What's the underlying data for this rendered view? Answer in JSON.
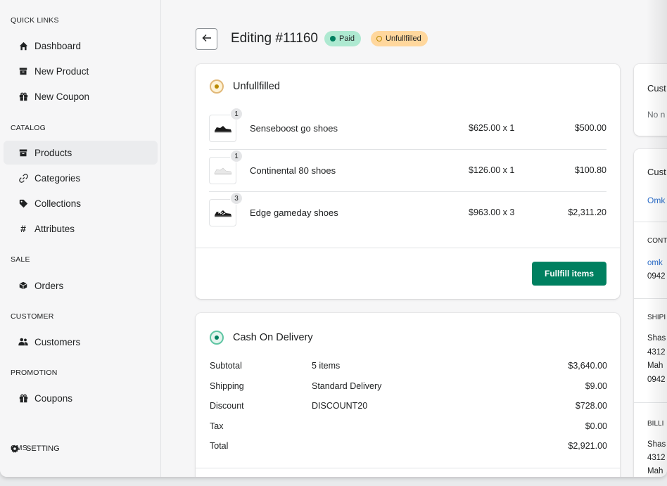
{
  "sidebar": {
    "sections": [
      {
        "title": "QUICK LINKS",
        "items": [
          {
            "label": "Dashboard",
            "icon": "home-icon"
          },
          {
            "label": "New Product",
            "icon": "box-icon"
          },
          {
            "label": "New Coupon",
            "icon": "gift-icon"
          }
        ]
      },
      {
        "title": "CATALOG",
        "items": [
          {
            "label": "Products",
            "icon": "box-icon",
            "active": true
          },
          {
            "label": "Categories",
            "icon": "link-icon"
          },
          {
            "label": "Collections",
            "icon": "tag-icon"
          },
          {
            "label": "Attributes",
            "icon": "hash-icon"
          }
        ]
      },
      {
        "title": "SALE",
        "items": [
          {
            "label": "Orders",
            "icon": "cube-icon"
          }
        ]
      },
      {
        "title": "CUSTOMER",
        "items": [
          {
            "label": "Customers",
            "icon": "users-icon"
          }
        ]
      },
      {
        "title": "PROMOTION",
        "items": [
          {
            "label": "Coupons",
            "icon": "gift-icon"
          }
        ]
      },
      {
        "title": "CMS",
        "items": [
          {
            "label": "SETTING",
            "icon": "gear-icon"
          }
        ]
      }
    ]
  },
  "header": {
    "title": "Editing #11160",
    "badges": {
      "paid": "Paid",
      "unfulfilled": "Unfullfilled"
    }
  },
  "unfulfilled_card": {
    "title": "Unfullfilled",
    "items": [
      {
        "qty": "1",
        "name": "Senseboost go shoes",
        "price": "$625.00 x 1",
        "total": "$500.00"
      },
      {
        "qty": "1",
        "name": "Continental 80 shoes",
        "price": "$126.00 x 1",
        "total": "$100.80"
      },
      {
        "qty": "3",
        "name": "Edge gameday shoes",
        "price": "$963.00 x 3",
        "total": "$2,311.20"
      }
    ],
    "button": "Fullfill items"
  },
  "payment_card": {
    "title": "Cash On Delivery",
    "rows": [
      {
        "label": "Subtotal",
        "detail": "5 items",
        "amount": "$3,640.00"
      },
      {
        "label": "Shipping",
        "detail": "Standard Delivery",
        "amount": "$9.00"
      },
      {
        "label": "Discount",
        "detail": "DISCOUNT20",
        "amount": "$728.00"
      },
      {
        "label": "Tax",
        "detail": "",
        "amount": "$0.00"
      },
      {
        "label": "Total",
        "detail": "",
        "amount": "$2,921.00"
      }
    ]
  },
  "right_panel": {
    "card1_title": "Cust",
    "card1_text": "No n",
    "card2_title": "Cust",
    "card2_link": "Omk",
    "contact_label": "CONT",
    "contact_email": "omk",
    "contact_phone": "0942",
    "shipping_label": "SHIPI",
    "shipping_lines": [
      "Shas",
      "4312",
      "Mah",
      "0942"
    ],
    "billing_label": "BILLI",
    "billing_lines": [
      "Shas",
      "4312",
      "Mah"
    ]
  },
  "colors": {
    "accent": "#008060",
    "paid_badge": "#aee9d1",
    "unfulfilled_badge": "#ffd79d",
    "link": "#2c6ecb"
  }
}
